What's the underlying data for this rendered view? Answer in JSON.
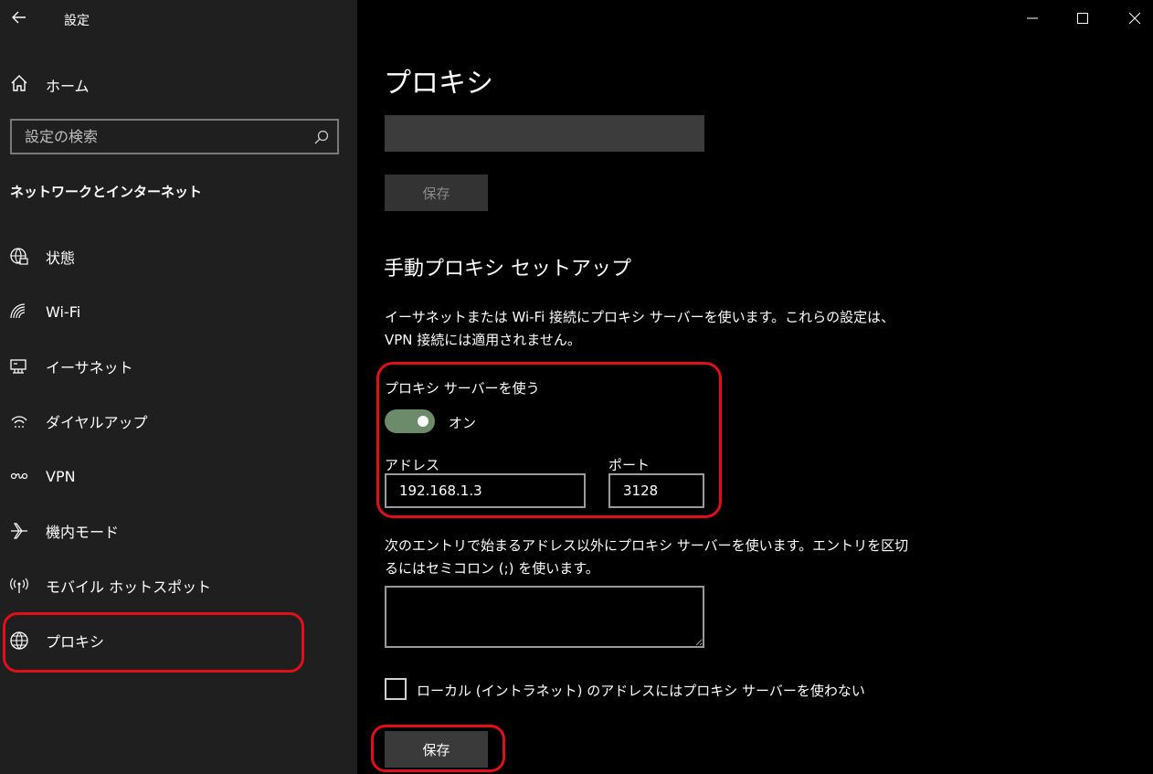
{
  "window": {
    "title": "設定",
    "colors": {
      "highlight": "#e0101a",
      "toggle_on": "#6b8b6b",
      "sidebar_bg": "#1f1f1f",
      "content_bg": "#000000"
    }
  },
  "sidebar": {
    "home_label": "ホーム",
    "search_placeholder": "設定の検索",
    "section_title": "ネットワークとインターネット",
    "items": [
      {
        "label": "状態",
        "icon": "globe-status-icon"
      },
      {
        "label": "Wi-Fi",
        "icon": "wifi-icon"
      },
      {
        "label": "イーサネット",
        "icon": "ethernet-icon"
      },
      {
        "label": "ダイヤルアップ",
        "icon": "dialup-icon"
      },
      {
        "label": "VPN",
        "icon": "vpn-icon"
      },
      {
        "label": "機内モード",
        "icon": "airplane-icon"
      },
      {
        "label": "モバイル ホットスポット",
        "icon": "hotspot-icon"
      },
      {
        "label": "プロキシ",
        "icon": "globe-icon"
      }
    ]
  },
  "main": {
    "title": "プロキシ",
    "script_save_label": "保存",
    "manual_heading": "手動プロキシ セットアップ",
    "manual_desc": "イーサネットまたは Wi-Fi 接続にプロキシ サーバーを使います。これらの設定は、VPN 接続には適用されません。",
    "use_proxy_label": "プロキシ サーバーを使う",
    "toggle_state": "オン",
    "address_label": "アドレス",
    "address_value": "192.168.1.3",
    "port_label": "ポート",
    "port_value": "3128",
    "exceptions_desc": "次のエントリで始まるアドレス以外にプロキシ サーバーを使います。エントリを区切るにはセミコロン (;) を使います。",
    "exceptions_value": "",
    "local_checkbox_label": "ローカル (イントラネット) のアドレスにはプロキシ サーバーを使わない",
    "local_checkbox_checked": false,
    "save_label": "保存"
  }
}
